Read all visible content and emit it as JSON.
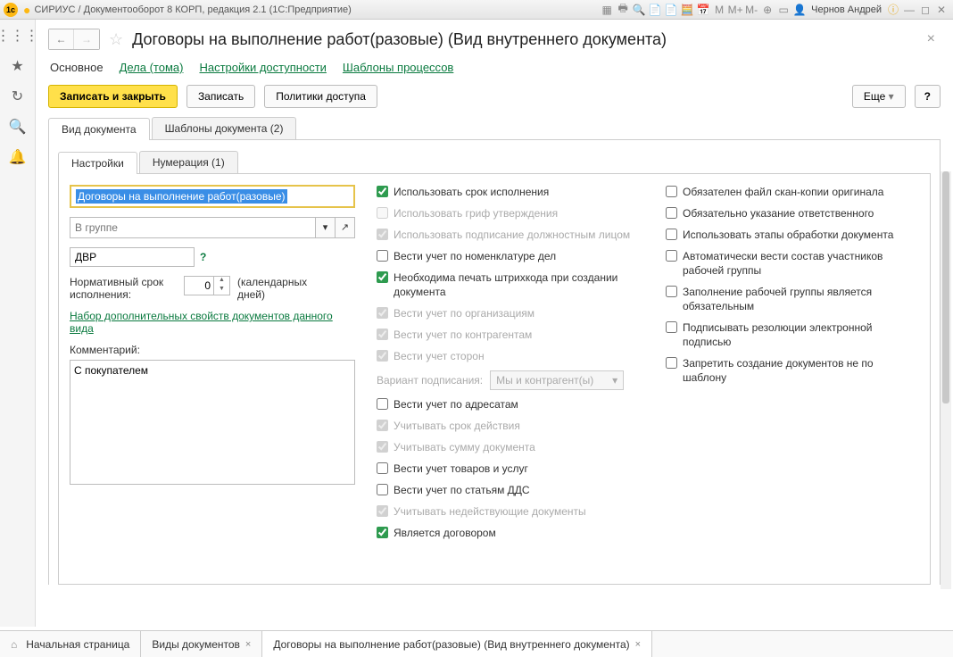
{
  "titlebar": {
    "app": "СИРИУС / Документооборот 8 КОРП, редакция 2.1  (1С:Предприятие)",
    "user": "Чернов Андрей"
  },
  "header": {
    "title": "Договоры на выполнение работ(разовые) (Вид внутреннего документа)"
  },
  "subnav": {
    "main": "Основное",
    "cases": "Дела (тома)",
    "access": "Настройки доступности",
    "templates": "Шаблоны процессов"
  },
  "cmd": {
    "save_close": "Записать и закрыть",
    "save": "Записать",
    "policies": "Политики доступа",
    "more": "Еще",
    "help": "?"
  },
  "tabs1": {
    "t1": "Вид документа",
    "t2": "Шаблоны документа (2)"
  },
  "tabs2": {
    "t1": "Настройки",
    "t2": "Нумерация (1)"
  },
  "col1": {
    "name": "Договоры на выполнение работ(разовые)",
    "group_ph": "В группе",
    "code": "ДВР",
    "norm_label": "Нормативный срок исполнения:",
    "norm_value": "0",
    "norm_units": "(календарных дней)",
    "extra_props": "Набор дополнительных свойств документов данного вида",
    "comment_label": "Комментарий:",
    "comment": "С покупателем"
  },
  "col2": {
    "c1": "Использовать срок исполнения",
    "c2": "Использовать гриф утверждения",
    "c3": "Использовать подписание должностным лицом",
    "c4": "Вести учет по номенклатуре дел",
    "c5": "Необходима печать штрихкода при создании документа",
    "c6": "Вести учет по организациям",
    "c7": "Вести учет по контрагентам",
    "c8": "Вести учет сторон",
    "var_label": "Вариант подписания:",
    "var_value": "Мы и контрагент(ы)",
    "c9": "Вести учет по адресатам",
    "c10": "Учитывать срок действия",
    "c11": "Учитывать сумму документа",
    "c12": "Вести учет товаров и услуг",
    "c13": "Вести учет по статьям ДДС",
    "c14": "Учитывать недействующие документы",
    "c15": "Является договором"
  },
  "col3": {
    "c1": "Обязателен файл скан-копии оригинала",
    "c2": "Обязательно указание ответственного",
    "c3": "Использовать этапы обработки документа",
    "c4": "Автоматически вести состав участников рабочей группы",
    "c5": "Заполнение рабочей группы является обязательным",
    "c6": "Подписывать резолюции электронной подписью",
    "c7": "Запретить создание документов не по шаблону"
  },
  "bottom": {
    "home": "Начальная страница",
    "t1": "Виды документов",
    "t2": "Договоры на выполнение работ(разовые) (Вид внутреннего документа)"
  }
}
